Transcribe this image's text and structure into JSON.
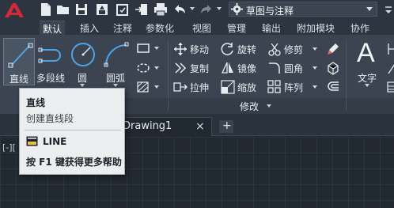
{
  "app": {
    "logo": "A"
  },
  "quick_access": {
    "icons": [
      "new-icon",
      "open-icon",
      "save-icon",
      "saveas-icon",
      "cloud-save-icon",
      "share-icon",
      "plot-icon",
      "undo-icon",
      "redo-icon"
    ],
    "workspace": "草图与注释"
  },
  "tabs": [
    "默认",
    "插入",
    "注释",
    "参数化",
    "视图",
    "管理",
    "输出",
    "附加模块",
    "协作"
  ],
  "active_tab": "默认",
  "ribbon": {
    "draw_tools": [
      {
        "label": "直线",
        "icon": "line-icon"
      },
      {
        "label": "多段线",
        "icon": "polyline-icon"
      },
      {
        "label": "圆",
        "icon": "circle-icon"
      },
      {
        "label": "圆弧",
        "icon": "arc-icon"
      }
    ],
    "modify_tools": [
      {
        "label": "移动",
        "icon": "move-icon"
      },
      {
        "label": "旋转",
        "icon": "rotate-icon"
      },
      {
        "label": "修剪",
        "icon": "trim-icon"
      },
      {
        "label": "复制",
        "icon": "copy-icon"
      },
      {
        "label": "镜像",
        "icon": "mirror-icon"
      },
      {
        "label": "圆角",
        "icon": "fillet-icon"
      },
      {
        "label": "拉伸",
        "icon": "stretch-icon"
      },
      {
        "label": "缩放",
        "icon": "scale-icon"
      },
      {
        "label": "阵列",
        "icon": "array-icon"
      }
    ],
    "modify_panel_label": "修改",
    "text_tool": {
      "label": "文字",
      "glyph": "A"
    }
  },
  "file_tabs": {
    "documents": [
      "Drawing1"
    ],
    "close": "×",
    "new": "+"
  },
  "viewport_control": "[-][",
  "tooltip": {
    "title": "直线",
    "description": "创建直线段",
    "command": "LINE",
    "help": "按 F1 键获得更多帮助"
  },
  "colors": {
    "accent": "#c0392b",
    "ribbon_bg": "#3b4450",
    "canvas_bg": "#212830",
    "tooltip_bg": "#ecedef"
  }
}
